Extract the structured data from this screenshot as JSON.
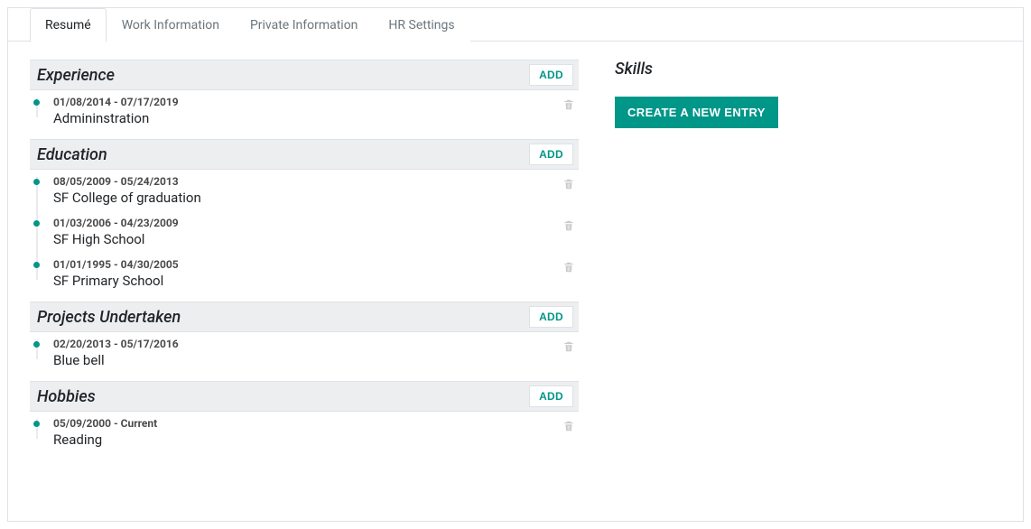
{
  "tabs": [
    {
      "label": "Resumé",
      "active": true
    },
    {
      "label": "Work Information",
      "active": false
    },
    {
      "label": "Private Information",
      "active": false
    },
    {
      "label": "HR Settings",
      "active": false
    }
  ],
  "add_label": "ADD",
  "sections": [
    {
      "key": "experience",
      "title": "Experience",
      "items": [
        {
          "dates": "01/08/2014 - 07/17/2019",
          "title": "Admininstration"
        }
      ]
    },
    {
      "key": "education",
      "title": "Education",
      "items": [
        {
          "dates": "08/05/2009 - 05/24/2013",
          "title": "SF College of graduation"
        },
        {
          "dates": "01/03/2006 - 04/23/2009",
          "title": "SF High School"
        },
        {
          "dates": "01/01/1995 - 04/30/2005",
          "title": "SF Primary School"
        }
      ]
    },
    {
      "key": "projects",
      "title": "Projects Undertaken",
      "items": [
        {
          "dates": "02/20/2013 - 05/17/2016",
          "title": "Blue bell"
        }
      ]
    },
    {
      "key": "hobbies",
      "title": "Hobbies",
      "items": [
        {
          "dates": "05/09/2000 - Current",
          "title": "Reading"
        }
      ]
    }
  ],
  "skills": {
    "title": "Skills",
    "create_label": "CREATE A NEW ENTRY"
  }
}
